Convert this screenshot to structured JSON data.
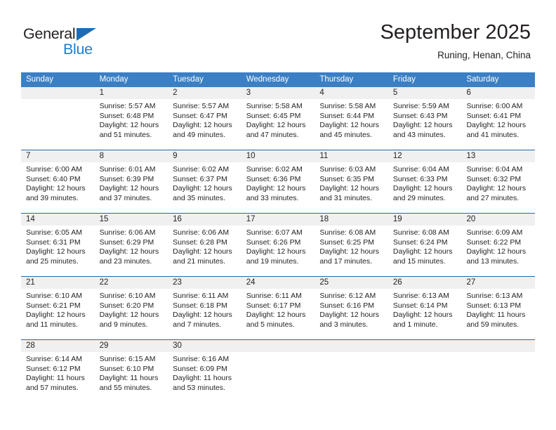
{
  "brand": {
    "name_part1": "General",
    "name_part2": "Blue",
    "accent_color": "#1f7fd0",
    "triangle_color": "#1d6cb3"
  },
  "header": {
    "month_title": "September 2025",
    "location": "Runing, Henan, China"
  },
  "calendar": {
    "header_color": "#3b7fc4",
    "row_separator_color": "#1f69ad",
    "daynum_band_color": "#f0f0f0",
    "weekdays": [
      "Sunday",
      "Monday",
      "Tuesday",
      "Wednesday",
      "Thursday",
      "Friday",
      "Saturday"
    ],
    "weeks": [
      [
        {
          "day": "",
          "lines": []
        },
        {
          "day": "1",
          "lines": [
            "Sunrise: 5:57 AM",
            "Sunset: 6:48 PM",
            "Daylight: 12 hours",
            "and 51 minutes."
          ]
        },
        {
          "day": "2",
          "lines": [
            "Sunrise: 5:57 AM",
            "Sunset: 6:47 PM",
            "Daylight: 12 hours",
            "and 49 minutes."
          ]
        },
        {
          "day": "3",
          "lines": [
            "Sunrise: 5:58 AM",
            "Sunset: 6:45 PM",
            "Daylight: 12 hours",
            "and 47 minutes."
          ]
        },
        {
          "day": "4",
          "lines": [
            "Sunrise: 5:58 AM",
            "Sunset: 6:44 PM",
            "Daylight: 12 hours",
            "and 45 minutes."
          ]
        },
        {
          "day": "5",
          "lines": [
            "Sunrise: 5:59 AM",
            "Sunset: 6:43 PM",
            "Daylight: 12 hours",
            "and 43 minutes."
          ]
        },
        {
          "day": "6",
          "lines": [
            "Sunrise: 6:00 AM",
            "Sunset: 6:41 PM",
            "Daylight: 12 hours",
            "and 41 minutes."
          ]
        }
      ],
      [
        {
          "day": "7",
          "lines": [
            "Sunrise: 6:00 AM",
            "Sunset: 6:40 PM",
            "Daylight: 12 hours",
            "and 39 minutes."
          ]
        },
        {
          "day": "8",
          "lines": [
            "Sunrise: 6:01 AM",
            "Sunset: 6:39 PM",
            "Daylight: 12 hours",
            "and 37 minutes."
          ]
        },
        {
          "day": "9",
          "lines": [
            "Sunrise: 6:02 AM",
            "Sunset: 6:37 PM",
            "Daylight: 12 hours",
            "and 35 minutes."
          ]
        },
        {
          "day": "10",
          "lines": [
            "Sunrise: 6:02 AM",
            "Sunset: 6:36 PM",
            "Daylight: 12 hours",
            "and 33 minutes."
          ]
        },
        {
          "day": "11",
          "lines": [
            "Sunrise: 6:03 AM",
            "Sunset: 6:35 PM",
            "Daylight: 12 hours",
            "and 31 minutes."
          ]
        },
        {
          "day": "12",
          "lines": [
            "Sunrise: 6:04 AM",
            "Sunset: 6:33 PM",
            "Daylight: 12 hours",
            "and 29 minutes."
          ]
        },
        {
          "day": "13",
          "lines": [
            "Sunrise: 6:04 AM",
            "Sunset: 6:32 PM",
            "Daylight: 12 hours",
            "and 27 minutes."
          ]
        }
      ],
      [
        {
          "day": "14",
          "lines": [
            "Sunrise: 6:05 AM",
            "Sunset: 6:31 PM",
            "Daylight: 12 hours",
            "and 25 minutes."
          ]
        },
        {
          "day": "15",
          "lines": [
            "Sunrise: 6:06 AM",
            "Sunset: 6:29 PM",
            "Daylight: 12 hours",
            "and 23 minutes."
          ]
        },
        {
          "day": "16",
          "lines": [
            "Sunrise: 6:06 AM",
            "Sunset: 6:28 PM",
            "Daylight: 12 hours",
            "and 21 minutes."
          ]
        },
        {
          "day": "17",
          "lines": [
            "Sunrise: 6:07 AM",
            "Sunset: 6:26 PM",
            "Daylight: 12 hours",
            "and 19 minutes."
          ]
        },
        {
          "day": "18",
          "lines": [
            "Sunrise: 6:08 AM",
            "Sunset: 6:25 PM",
            "Daylight: 12 hours",
            "and 17 minutes."
          ]
        },
        {
          "day": "19",
          "lines": [
            "Sunrise: 6:08 AM",
            "Sunset: 6:24 PM",
            "Daylight: 12 hours",
            "and 15 minutes."
          ]
        },
        {
          "day": "20",
          "lines": [
            "Sunrise: 6:09 AM",
            "Sunset: 6:22 PM",
            "Daylight: 12 hours",
            "and 13 minutes."
          ]
        }
      ],
      [
        {
          "day": "21",
          "lines": [
            "Sunrise: 6:10 AM",
            "Sunset: 6:21 PM",
            "Daylight: 12 hours",
            "and 11 minutes."
          ]
        },
        {
          "day": "22",
          "lines": [
            "Sunrise: 6:10 AM",
            "Sunset: 6:20 PM",
            "Daylight: 12 hours",
            "and 9 minutes."
          ]
        },
        {
          "day": "23",
          "lines": [
            "Sunrise: 6:11 AM",
            "Sunset: 6:18 PM",
            "Daylight: 12 hours",
            "and 7 minutes."
          ]
        },
        {
          "day": "24",
          "lines": [
            "Sunrise: 6:11 AM",
            "Sunset: 6:17 PM",
            "Daylight: 12 hours",
            "and 5 minutes."
          ]
        },
        {
          "day": "25",
          "lines": [
            "Sunrise: 6:12 AM",
            "Sunset: 6:16 PM",
            "Daylight: 12 hours",
            "and 3 minutes."
          ]
        },
        {
          "day": "26",
          "lines": [
            "Sunrise: 6:13 AM",
            "Sunset: 6:14 PM",
            "Daylight: 12 hours",
            "and 1 minute."
          ]
        },
        {
          "day": "27",
          "lines": [
            "Sunrise: 6:13 AM",
            "Sunset: 6:13 PM",
            "Daylight: 11 hours",
            "and 59 minutes."
          ]
        }
      ],
      [
        {
          "day": "28",
          "lines": [
            "Sunrise: 6:14 AM",
            "Sunset: 6:12 PM",
            "Daylight: 11 hours",
            "and 57 minutes."
          ]
        },
        {
          "day": "29",
          "lines": [
            "Sunrise: 6:15 AM",
            "Sunset: 6:10 PM",
            "Daylight: 11 hours",
            "and 55 minutes."
          ]
        },
        {
          "day": "30",
          "lines": [
            "Sunrise: 6:16 AM",
            "Sunset: 6:09 PM",
            "Daylight: 11 hours",
            "and 53 minutes."
          ]
        },
        {
          "day": "",
          "lines": []
        },
        {
          "day": "",
          "lines": []
        },
        {
          "day": "",
          "lines": []
        },
        {
          "day": "",
          "lines": []
        }
      ]
    ]
  }
}
